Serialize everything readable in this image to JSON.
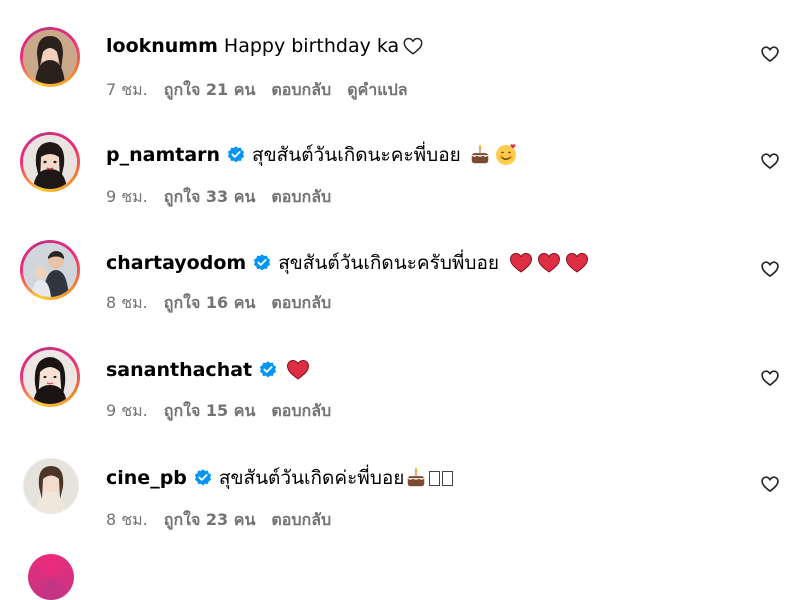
{
  "comments": [
    {
      "username": "looknumm",
      "verified": false,
      "text": "Happy birthday ka",
      "time": "7 ชม.",
      "likes": "ถูกใจ 21 คน",
      "reply": "ตอบกลับ",
      "translate": "ดูคำแปล",
      "emoji": [
        "white-heart-icon"
      ]
    },
    {
      "username": "p_namtarn",
      "verified": true,
      "text": "สุขสันต์วันเกิดนะคะพี่บอย",
      "time": "9 ชม.",
      "likes": "ถูกใจ 33 คน",
      "reply": "ตอบกลับ",
      "emoji": [
        "birthday-cake-icon",
        "smiling-face-with-hearts-icon"
      ]
    },
    {
      "username": "chartayodom",
      "verified": true,
      "text": "สุขสันต์วันเกิดนะครับพี่บอย",
      "time": "8 ชม.",
      "likes": "ถูกใจ 16 คน",
      "reply": "ตอบกลับ",
      "emoji": [
        "red-heart-icon",
        "red-heart-icon",
        "red-heart-icon"
      ]
    },
    {
      "username": "sananthachat",
      "verified": true,
      "text": "",
      "time": "9 ชม.",
      "likes": "ถูกใจ 15 คน",
      "reply": "ตอบกลับ",
      "emoji": [
        "red-heart-icon"
      ]
    },
    {
      "username": "cine_pb",
      "verified": true,
      "text": "สุขสันต์วันเกิดค่ะพี่บอย",
      "time": "8 ชม.",
      "likes": "ถูกใจ 23 คน",
      "reply": "ตอบกลับ",
      "emoji": [
        "birthday-cake-icon",
        "unrendered-glyph-box",
        "unrendered-glyph-box"
      ]
    }
  ],
  "colors": {
    "verified_blue": "#0095f6",
    "meta_gray": "#737373",
    "heart_red": "#e0245e"
  }
}
